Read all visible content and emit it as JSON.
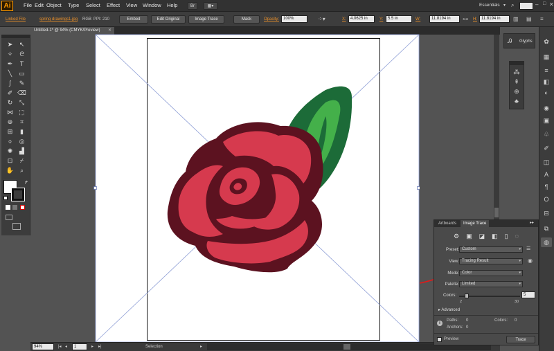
{
  "app": {
    "logo": "Ai",
    "menu": [
      "File",
      "Edit",
      "Object",
      "Type",
      "Select",
      "Effect",
      "View",
      "Window",
      "Help"
    ],
    "workspace": "Essentials",
    "search_placeholder": ""
  },
  "control_bar": {
    "linked_file": "Linked File",
    "filename": "spring drawings1.jpg",
    "color_mode": "RGB",
    "ppi": "PPI: 210",
    "embed": "Embed",
    "edit_original": "Edit Original",
    "image_trace": "Image Trace",
    "mask": "Mask",
    "opacity_label": "Opacity:",
    "opacity_value": "100%",
    "x_label": "X:",
    "x_value": "4.0625 in",
    "y_label": "Y:",
    "y_value": "5.5 in",
    "w_label": "W:",
    "w_value": "11.8194 in",
    "h_label": "H:",
    "h_value": "11.8194 in"
  },
  "document": {
    "tab_title": "Untitled-1* @ 94% (CMYK/Preview)"
  },
  "status": {
    "zoom": "94%",
    "page": "1",
    "tool": "Selection"
  },
  "glyphs_panel": {
    "title": "Glyphs"
  },
  "image_trace_panel": {
    "tab_artboards": "Artboards",
    "tab_image_trace": "Image Trace",
    "preset_label": "Preset:",
    "preset_value": "Custom",
    "view_label": "View:",
    "view_value": "Tracing Result",
    "mode_label": "Mode:",
    "mode_value": "Color",
    "palette_label": "Palette:",
    "palette_value": "Limited",
    "colors_label": "Colors:",
    "colors_value": "5",
    "colors_min": "2",
    "colors_max": "30",
    "colors_level": 0.1,
    "advanced": "Advanced",
    "paths_label": "Paths:",
    "paths_value": "0",
    "colors_count_label": "Colors:",
    "colors_count_value": "0",
    "anchors_label": "Anchors:",
    "anchors_value": "0",
    "preview": "Preview",
    "trace": "Trace"
  },
  "colors": {
    "rose_dark": "#5c1220",
    "rose_petal": "#d63a4e",
    "leaf_dark": "#1c6b38",
    "leaf_light": "#44b04a",
    "annotation_red": "#e01a1a"
  }
}
